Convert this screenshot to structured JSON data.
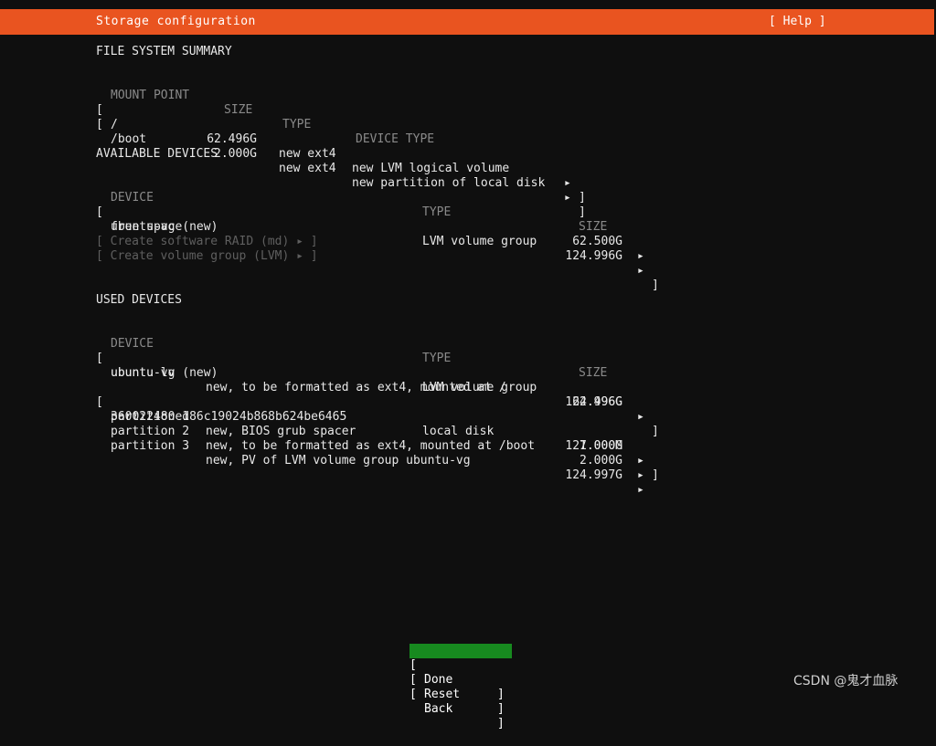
{
  "header": {
    "title": "Storage configuration",
    "help_label": "[ Help ]",
    "bar_color": "#e95420"
  },
  "sections": {
    "file_system_summary": {
      "heading": "FILE SYSTEM SUMMARY",
      "columns": {
        "mount_point": "MOUNT POINT",
        "size": "SIZE",
        "type": "TYPE",
        "device_type": "DEVICE TYPE"
      },
      "rows": [
        {
          "bracket_left": "[",
          "mount_point": "/",
          "size": "62.496G",
          "type": "new ext4",
          "device_type": "new LVM logical volume",
          "arrow": "▸",
          "bracket_right": "]"
        },
        {
          "bracket_left": "[",
          "mount_point": "/boot",
          "size": "2.000G",
          "type": "new ext4",
          "device_type": "new partition of local disk",
          "arrow": "▸",
          "bracket_right": "]"
        }
      ]
    },
    "available_devices": {
      "heading": "AVAILABLE DEVICES",
      "columns": {
        "device": "DEVICE",
        "type": "TYPE",
        "size": "SIZE"
      },
      "rows": [
        {
          "bracket_left": "[",
          "device": "ubuntu-vg (new)",
          "type": "LVM volume group",
          "size": "124.996G",
          "arrow": "▸",
          "bracket_right": "]"
        },
        {
          "bracket_left": "",
          "device": "free space",
          "type": "",
          "size": "62.500G",
          "arrow": "▸",
          "bracket_right": ""
        }
      ],
      "actions": [
        {
          "label": "[ Create software RAID (md) ▸ ]",
          "disabled": true
        },
        {
          "label": "[ Create volume group (LVM) ▸ ]",
          "disabled": true
        }
      ]
    },
    "used_devices": {
      "heading": "USED DEVICES",
      "columns": {
        "device": "DEVICE",
        "type": "TYPE",
        "size": "SIZE"
      },
      "group_one": {
        "bracket_left": "[",
        "device": "ubuntu-vg (new)",
        "type": "LVM volume group",
        "size": "124.996G",
        "arrow": "▸",
        "bracket_right": "]",
        "children": [
          {
            "name": "ubuntu-lv",
            "description": "new, to be formatted as ext4, mounted at /",
            "size": "62.496G",
            "arrow": "▸"
          }
        ]
      },
      "group_two": {
        "bracket_left": "[",
        "device": "360022480ed86c19024b868b624be6465",
        "type": "local disk",
        "size": "127.000G",
        "arrow": "▸",
        "bracket_right": "]",
        "children": [
          {
            "name": "partition 1",
            "description": "new, BIOS grub spacer",
            "size": "1.000M",
            "arrow": "▸"
          },
          {
            "name": "partition 2",
            "description": "new, to be formatted as ext4, mounted at /boot",
            "size": "2.000G",
            "arrow": "▸"
          },
          {
            "name": "partition 3",
            "description": "new, PV of LVM volume group ubuntu-vg",
            "size": "124.997G",
            "arrow": "▸"
          }
        ]
      }
    }
  },
  "buttons": {
    "bracket_left": "[",
    "bracket_right": "]",
    "selected_color": "#178a1f",
    "items": [
      {
        "label": "Done",
        "selected": true
      },
      {
        "label": "Reset",
        "selected": false
      },
      {
        "label": "Back",
        "selected": false
      }
    ]
  },
  "watermark": {
    "text": "CSDN @鬼才血脉"
  }
}
